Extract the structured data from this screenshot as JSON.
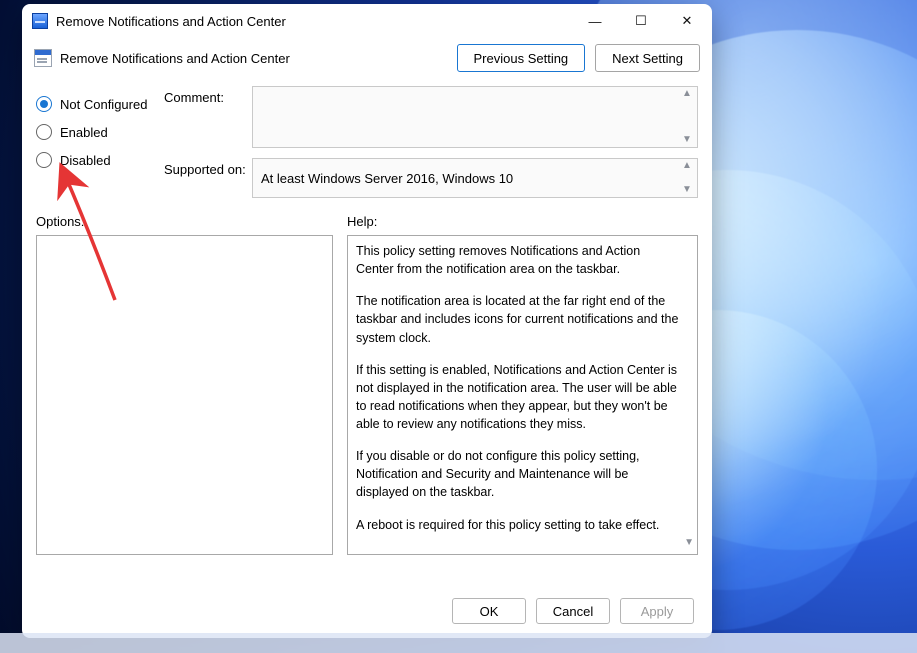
{
  "window": {
    "title": "Remove Notifications and Action Center",
    "header_title": "Remove Notifications and Action Center"
  },
  "nav": {
    "prev": "Previous Setting",
    "next": "Next Setting"
  },
  "state": {
    "not_configured": "Not Configured",
    "enabled": "Enabled",
    "disabled": "Disabled",
    "selected": "not_configured"
  },
  "form": {
    "comment_label": "Comment:",
    "comment_value": "",
    "supported_label": "Supported on:",
    "supported_value": "At least Windows Server 2016, Windows 10"
  },
  "sections": {
    "options": "Options:",
    "help": "Help:"
  },
  "help": {
    "p1": "This policy setting removes Notifications and Action Center from the notification area on the taskbar.",
    "p2": "The notification area is located at the far right end of the taskbar and includes icons for current notifications and the system clock.",
    "p3": "If this setting is enabled, Notifications and Action Center is not displayed in the notification area. The user will be able to read notifications when they appear, but they won't be able to review any notifications they miss.",
    "p4": "If you disable or do not configure this policy setting, Notification and Security and Maintenance will be displayed on the taskbar.",
    "p5": "A reboot is required for this policy setting to take effect."
  },
  "footer": {
    "ok": "OK",
    "cancel": "Cancel",
    "apply": "Apply"
  },
  "glyphs": {
    "min": "—",
    "max": "☐",
    "close": "✕",
    "tri_up": "▲",
    "tri_down": "▼"
  }
}
